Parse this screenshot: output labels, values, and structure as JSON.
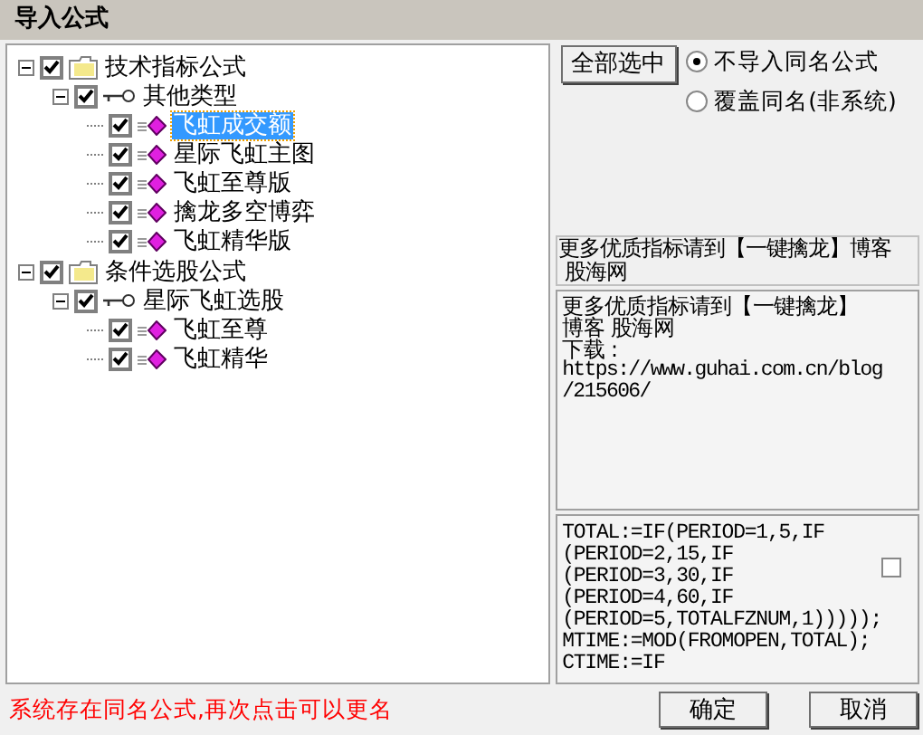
{
  "window": {
    "title": "导入公式"
  },
  "tree": [
    {
      "label": "技术指标公式",
      "kind": "folder",
      "checked": true,
      "expanded": true,
      "selected": false,
      "children": [
        {
          "label": "其他类型",
          "kind": "group",
          "checked": true,
          "expanded": true,
          "selected": false,
          "children": [
            {
              "label": "飞虹成交额",
              "kind": "formula",
              "checked": true,
              "selected": true
            },
            {
              "label": "星际飞虹主图",
              "kind": "formula",
              "checked": true,
              "selected": false
            },
            {
              "label": "飞虹至尊版",
              "kind": "formula",
              "checked": true,
              "selected": false
            },
            {
              "label": "擒龙多空博弈",
              "kind": "formula",
              "checked": true,
              "selected": false
            },
            {
              "label": "飞虹精华版",
              "kind": "formula",
              "checked": true,
              "selected": false
            }
          ]
        }
      ]
    },
    {
      "label": "条件选股公式",
      "kind": "folder",
      "checked": true,
      "expanded": true,
      "selected": false,
      "children": [
        {
          "label": "星际飞虹选股",
          "kind": "group",
          "checked": true,
          "expanded": true,
          "selected": false,
          "children": [
            {
              "label": "飞虹至尊",
              "kind": "formula",
              "checked": true,
              "selected": false
            },
            {
              "label": "飞虹精华",
              "kind": "formula",
              "checked": true,
              "selected": false
            }
          ]
        }
      ]
    }
  ],
  "select_all_button": "全部选中",
  "radios": [
    {
      "label": "不导入同名公式",
      "selected": true
    },
    {
      "label": "覆盖同名(非系统)",
      "selected": false
    }
  ],
  "description_label": [
    "更多优质指标请到【一键擒龙】博客",
    " 股海网"
  ],
  "description_lines": [
    "更多优质指标请到【一键擒龙】",
    "博客  股海网",
    "下载 :",
    "https://www.guhai.com.cn/blog",
    "/215606/"
  ],
  "code_lines": [
    "TOTAL:=IF(PERIOD=1,5,IF",
    "(PERIOD=2,15,IF",
    "(PERIOD=3,30,IF",
    "(PERIOD=4,60,IF",
    "(PERIOD=5,TOTALFZNUM,1)))));",
    "MTIME:=MOD(FROMOPEN,TOTAL);",
    "CTIME:=IF"
  ],
  "code_checkbox": {
    "checked": false
  },
  "status": "系统存在同名公式,再次点击可以更名",
  "buttons": [
    "确定",
    "取消"
  ]
}
